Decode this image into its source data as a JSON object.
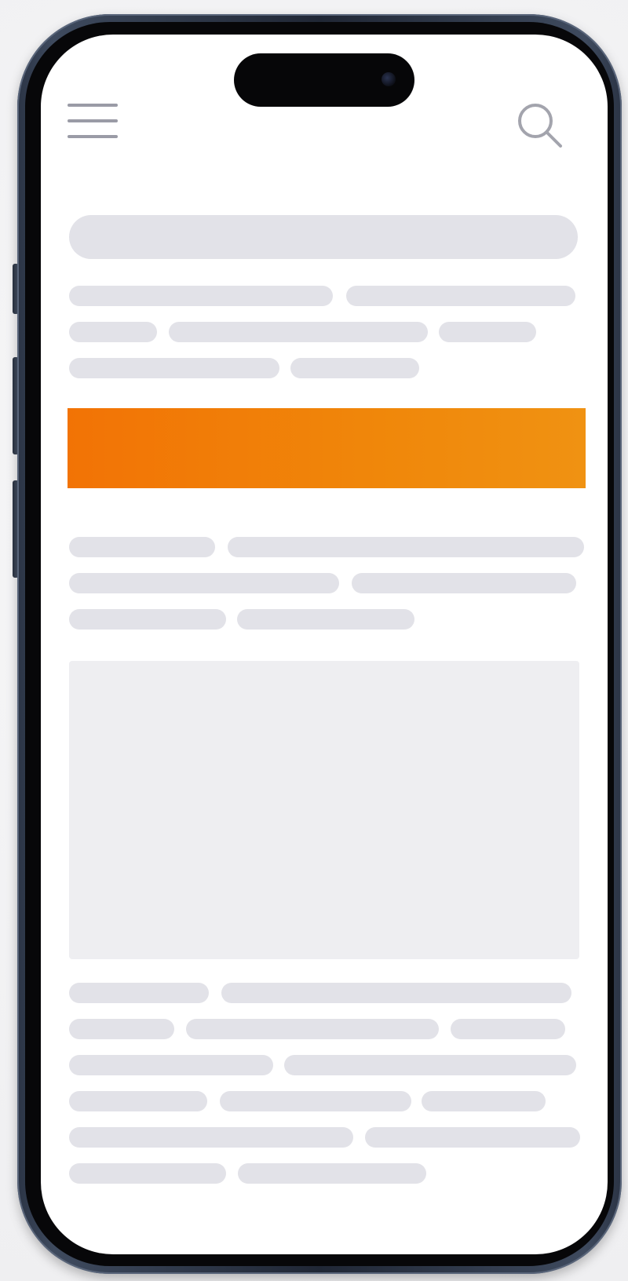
{
  "device": {
    "frame_color": "#2b3445",
    "screen_color": "#ffffff"
  },
  "header": {
    "menu_icon": "hamburger-menu-icon",
    "search_icon": "search-icon"
  },
  "banner": {
    "colors": [
      "#f27305",
      "#f09212"
    ]
  },
  "skeleton": {
    "color": "#e2e2e8",
    "media_color": "#eeeef1"
  }
}
